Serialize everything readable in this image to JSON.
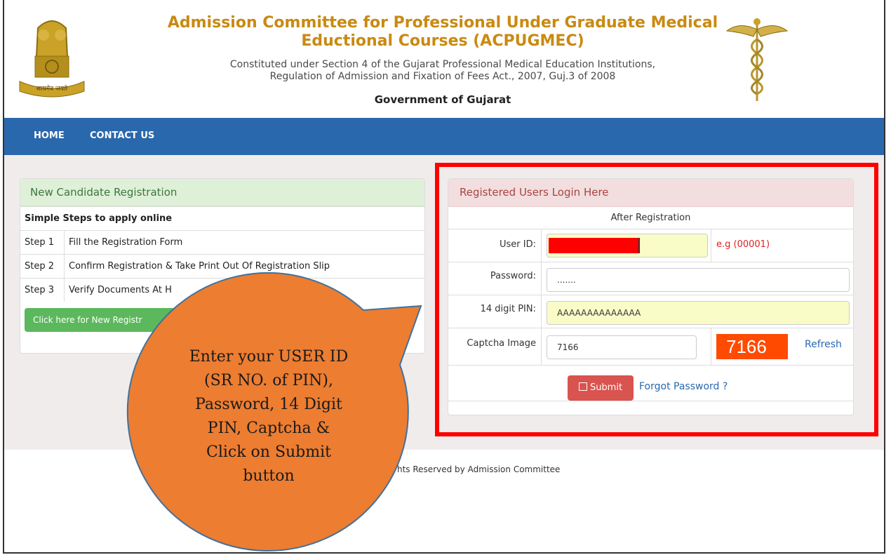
{
  "header": {
    "title_line1": "Admission Committee for Professional Under Graduate Medical",
    "title_line2": "Eductional Courses (ACPUGMEC)",
    "subtitle_line1": "Constituted under Section 4 of the Gujarat Professional Medical Education Institutions,",
    "subtitle_line2": "Regulation of Admission and Fixation of Fees Act., 2007, Guj.3 of 2008",
    "government": "Government of Gujarat",
    "emblem_text": "सत्यमेव जयते"
  },
  "nav": {
    "home": "HOME",
    "contact": "CONTACT US"
  },
  "left_panel": {
    "heading": "New Candidate Registration",
    "steps_title": "Simple Steps to apply online",
    "steps": [
      {
        "step": "Step 1",
        "text": "Fill the Registration Form"
      },
      {
        "step": "Step 2",
        "text": "Confirm Registration & Take Print Out Of Registration Slip"
      },
      {
        "step": "Step 3",
        "text": "Verify Documents At H"
      }
    ],
    "register_button": "Click here for New Registr"
  },
  "login": {
    "heading": "Registered Users Login Here",
    "subheading": "After Registration",
    "user_id_label": "User ID:",
    "user_id_hint": "e.g (00001)",
    "password_label": "Password:",
    "password_value": ".......",
    "pin_label": "14 digit PIN:",
    "pin_value": "AAAAAAAAAAAAAA",
    "captcha_label": "Captcha Image",
    "captcha_value": "7166",
    "captcha_image_text": "7166",
    "refresh": "Refresh",
    "submit": "Submit",
    "forgot": "Forgot Password ?"
  },
  "footer": {
    "text": "hts Reserved by Admission Committee"
  },
  "callout": {
    "lines": [
      "Enter your USER ID",
      "(SR NO. of PIN),",
      "Password, 14 Digit",
      "PIN, Captcha &",
      "Click on Submit",
      "button"
    ]
  },
  "colors": {
    "nav": "#2a68ad",
    "callout": "#ed7d31",
    "highlight_border": "#ff0000",
    "submit": "#d9534f"
  }
}
